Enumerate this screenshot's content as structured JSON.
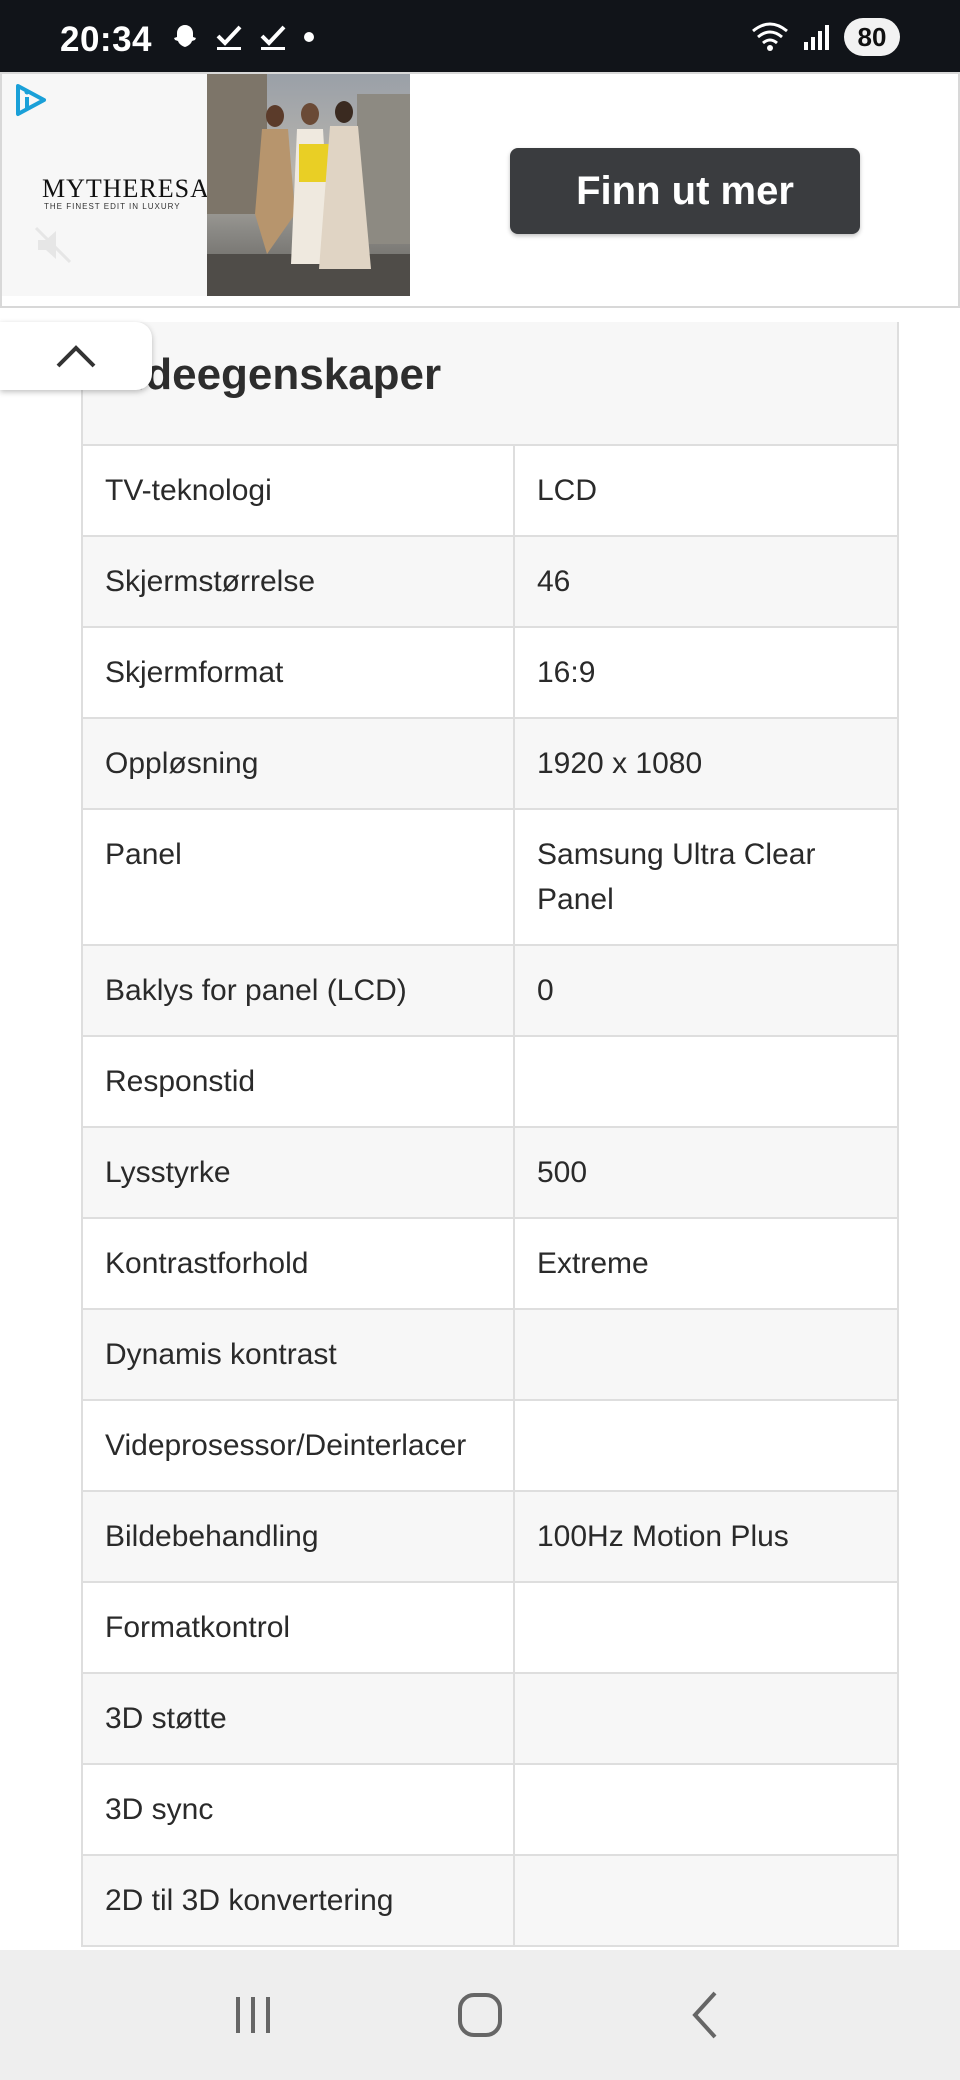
{
  "status_bar": {
    "time": "20:34",
    "battery": "80",
    "icons": [
      "snapchat-icon",
      "check-icon",
      "check-icon",
      "dot-icon",
      "wifi-icon",
      "signal-icon"
    ]
  },
  "ad": {
    "brand": "MYTHERESA",
    "tagline": "THE FINEST EDIT IN LUXURY",
    "cta_label": "Finn ut mer",
    "icons": [
      "adchoices-icon",
      "mute-icon"
    ]
  },
  "section": {
    "title": "Bildeegenskaper",
    "visible_title": "ldeegenskaper"
  },
  "rows": [
    {
      "key": "TV-teknologi",
      "value": "LCD"
    },
    {
      "key": "Skjermstørrelse",
      "value": "46"
    },
    {
      "key": "Skjermformat",
      "value": "16:9"
    },
    {
      "key": "Oppløsning",
      "value": "1920 x 1080"
    },
    {
      "key": "Panel",
      "value": "Samsung Ultra Clear Panel"
    },
    {
      "key": "Baklys for panel (LCD)",
      "value": "0"
    },
    {
      "key": "Responstid",
      "value": ""
    },
    {
      "key": "Lysstyrke",
      "value": "500"
    },
    {
      "key": "Kontrastforhold",
      "value": "Extreme"
    },
    {
      "key": "Dynamis kontrast",
      "value": ""
    },
    {
      "key": "Videprosessor/Deinterlacer",
      "value": ""
    },
    {
      "key": "Bildebehandling",
      "value": "100Hz Motion Plus"
    },
    {
      "key": "Formatkontrol",
      "value": ""
    },
    {
      "key": "3D støtte",
      "value": ""
    },
    {
      "key": "3D sync",
      "value": ""
    },
    {
      "key": "2D til 3D konvertering",
      "value": ""
    }
  ],
  "colors": {
    "status_bar_bg": "#111419",
    "cta_bg": "#3a3c3f",
    "row_alt_bg": "#f7f7f7",
    "border": "#dedede",
    "navbar_bg": "#eeeeee"
  }
}
